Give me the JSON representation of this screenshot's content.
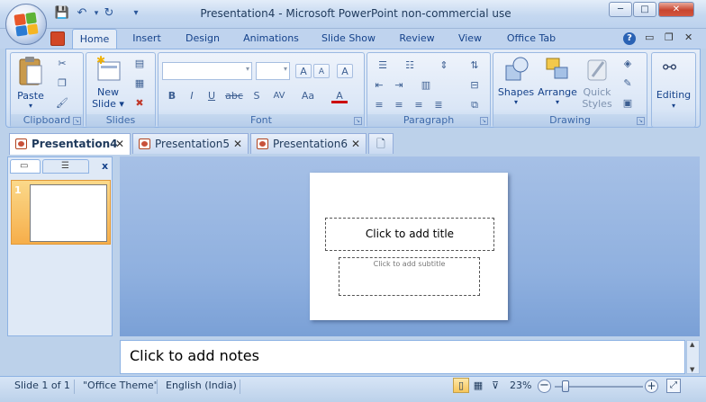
{
  "window": {
    "title": "Presentation4 - Microsoft PowerPoint non-commercial use",
    "controls": {
      "minimize": "─",
      "maximize": "□",
      "close": "✕"
    }
  },
  "quick_access": {
    "save": "💾",
    "undo": "↶",
    "redo": "↻",
    "customize": "▾"
  },
  "ribbon_tabs": [
    {
      "label": "Home"
    },
    {
      "label": "Insert"
    },
    {
      "label": "Design"
    },
    {
      "label": "Animations"
    },
    {
      "label": "Slide Show"
    },
    {
      "label": "Review"
    },
    {
      "label": "View"
    },
    {
      "label": "Office Tab"
    }
  ],
  "ribbon_right": {
    "help": "?",
    "minimize": "▭",
    "restore": "❐",
    "close": "✕"
  },
  "groups": {
    "clipboard": {
      "label": "Clipboard",
      "paste": "Paste"
    },
    "slides": {
      "label": "Slides",
      "new_slide_line1": "New",
      "new_slide_line2": "Slide ▾"
    },
    "font": {
      "label": "Font",
      "grow": "A",
      "shrink": "A",
      "clear": "A",
      "bold": "B",
      "italic": "I",
      "underline": "U",
      "strike": "abc",
      "shadow": "S",
      "spacing": "AV",
      "case": "Aa",
      "color": "A"
    },
    "paragraph": {
      "label": "Paragraph"
    },
    "drawing": {
      "label": "Drawing",
      "shapes": "Shapes",
      "arrange": "Arrange",
      "quick_styles_line1": "Quick",
      "quick_styles_line2": "Styles"
    },
    "editing": {
      "label": "Editing"
    }
  },
  "doc_tabs": [
    {
      "label": "Presentation4",
      "active": true
    },
    {
      "label": "Presentation5",
      "active": false
    },
    {
      "label": "Presentation6",
      "active": false
    }
  ],
  "left_pane": {
    "close": "x",
    "slide_number": "1"
  },
  "slide": {
    "title_placeholder": "Click to add title",
    "subtitle_placeholder": "Click to add subtitle"
  },
  "notes_placeholder": "Click to add notes",
  "status": {
    "slide_info": "Slide 1 of 1",
    "theme": "\"Office Theme\"",
    "language": "English (India)",
    "zoom": "23%",
    "zoom_level": 0.08
  },
  "colors": {
    "accent": "#15428b",
    "ribbon_bg": "#dae6f6",
    "selected_thumb": "#f6ae4a",
    "canvas": "#8fb0df"
  }
}
